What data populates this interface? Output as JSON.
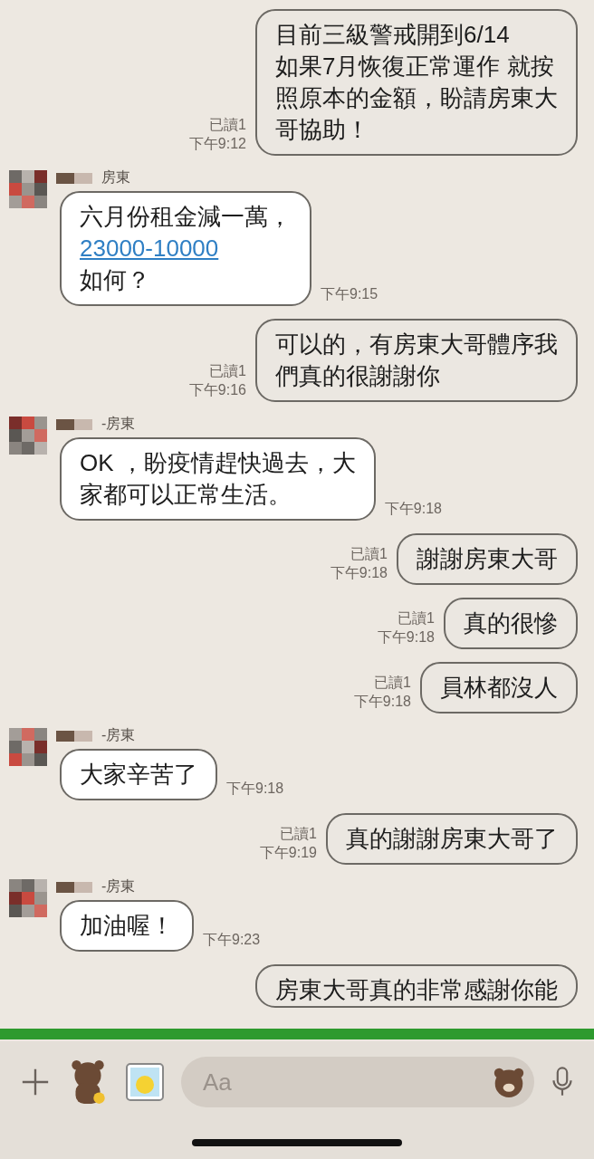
{
  "messages": [
    {
      "kind": "out",
      "read": "已讀1",
      "time": "下午9:12",
      "lines": [
        {
          "kind": "plain",
          "text": "目前三級警戒開到6/14"
        },
        {
          "kind": "plain",
          "text": "如果7月恢復正常運作 就按"
        },
        {
          "kind": "plain",
          "text": "照原本的金額，盼請房東大"
        },
        {
          "kind": "plain",
          "text": "哥協助！"
        }
      ]
    },
    {
      "kind": "in",
      "sender": "房東",
      "time": "下午9:15",
      "lines": [
        {
          "kind": "plain",
          "text": "六月份租金減一萬，"
        },
        {
          "kind": "link",
          "text": "23000-10000"
        },
        {
          "kind": "plain",
          "text": "如何？"
        }
      ]
    },
    {
      "kind": "out",
      "read": "已讀1",
      "time": "下午9:16",
      "lines": [
        {
          "kind": "plain",
          "text": "可以的，有房東大哥體序我"
        },
        {
          "kind": "plain",
          "text": "們真的很謝謝你"
        }
      ]
    },
    {
      "kind": "in",
      "sender": "-房東",
      "time": "下午9:18",
      "lines": [
        {
          "kind": "plain",
          "text": "OK ，盼疫情趕快過去，大"
        },
        {
          "kind": "plain",
          "text": "家都可以正常生活。"
        }
      ]
    },
    {
      "kind": "out",
      "read": "已讀1",
      "time": "下午9:18",
      "lines": [
        {
          "kind": "plain",
          "text": "謝謝房東大哥"
        }
      ]
    },
    {
      "kind": "out",
      "read": "已讀1",
      "time": "下午9:18",
      "lines": [
        {
          "kind": "plain",
          "text": "真的很慘"
        }
      ]
    },
    {
      "kind": "out",
      "read": "已讀1",
      "time": "下午9:18",
      "lines": [
        {
          "kind": "plain",
          "text": "員林都沒人"
        }
      ]
    },
    {
      "kind": "in",
      "sender": "-房東",
      "time": "下午9:18",
      "lines": [
        {
          "kind": "plain",
          "text": "大家辛苦了"
        }
      ]
    },
    {
      "kind": "out",
      "read": "已讀1",
      "time": "下午9:19",
      "lines": [
        {
          "kind": "plain",
          "text": "真的謝謝房東大哥了"
        }
      ]
    },
    {
      "kind": "in",
      "sender": "-房東",
      "time": "下午9:23",
      "lines": [
        {
          "kind": "plain",
          "text": "加油喔！"
        }
      ]
    },
    {
      "kind": "out",
      "lines": [
        {
          "kind": "plain",
          "text": "房東大哥真的非常感謝你能"
        }
      ]
    }
  ],
  "composer": {
    "placeholder": "Aa"
  }
}
